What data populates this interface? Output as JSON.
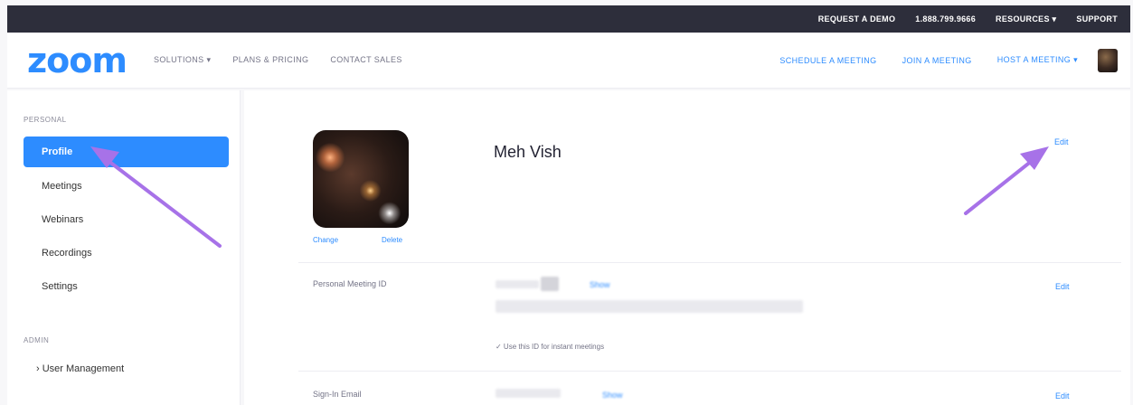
{
  "topbar": {
    "links": [
      "REQUEST A DEMO",
      "1.888.799.9666",
      "RESOURCES ▾",
      "SUPPORT"
    ]
  },
  "header": {
    "logo": "zoom",
    "nav_left": [
      "SOLUTIONS ▾",
      "PLANS & PRICING",
      "CONTACT SALES"
    ],
    "nav_right": [
      "SCHEDULE A MEETING",
      "JOIN A MEETING",
      "HOST A MEETING ▾"
    ]
  },
  "sidebar": {
    "personal_section": "PERSONAL",
    "personal_items": [
      "Profile",
      "Meetings",
      "Webinars",
      "Recordings",
      "Settings"
    ],
    "active_item": "Profile",
    "admin_section": "ADMIN",
    "admin_items": [
      "› User Management"
    ]
  },
  "profile": {
    "name": "Meh Vish",
    "edit_label": "Edit",
    "photo_change": "Change",
    "photo_delete": "Delete",
    "pmi_label": "Personal Meeting ID",
    "pmi_show": "Show",
    "pmi_edit": "Edit",
    "pmi_note": "✓ Use this ID for instant meetings",
    "email_label": "Sign-In Email",
    "email_show": "Show",
    "email_edit": "Edit"
  },
  "colors": {
    "accent": "#2d8cff",
    "topbar": "#2d2e3b",
    "arrow": "#a772e8"
  }
}
